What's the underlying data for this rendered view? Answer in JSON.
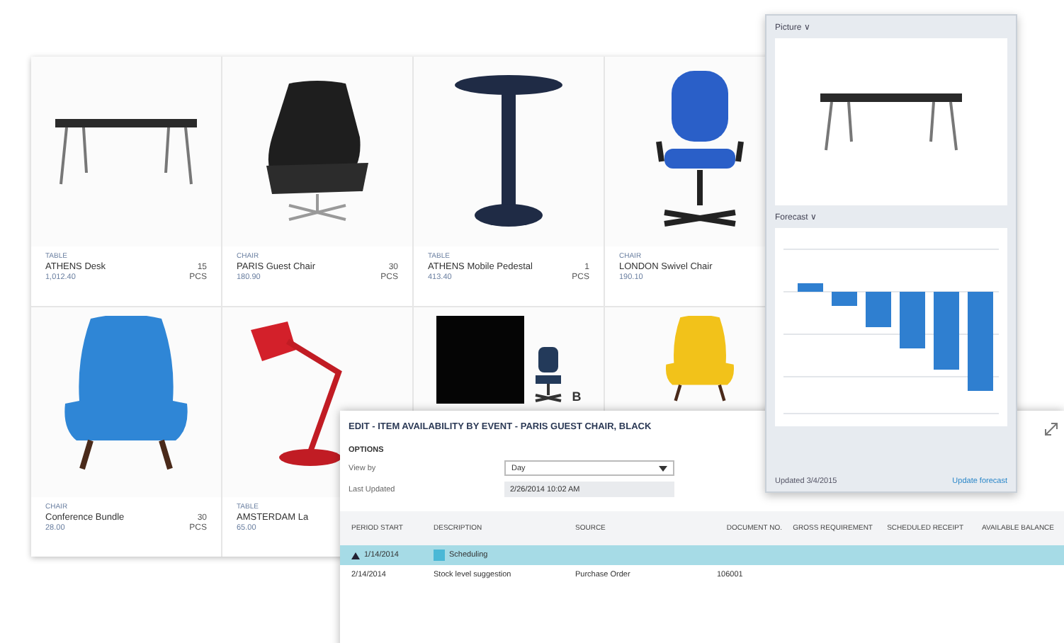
{
  "products": [
    {
      "kind": "desk",
      "category": "TABLE",
      "name": "ATHENS Desk",
      "quantity": "15",
      "price": "1,012.40",
      "unit": "PCS"
    },
    {
      "kind": "lounge",
      "category": "CHAIR",
      "name": "PARIS Guest Chair",
      "quantity": "30",
      "price": "180.90",
      "unit": "PCS"
    },
    {
      "kind": "pedestal",
      "category": "TABLE",
      "name": "ATHENS Mobile Pedestal",
      "quantity": "1",
      "price": "413.40",
      "unit": "PCS"
    },
    {
      "kind": "office",
      "category": "CHAIR",
      "name": "LONDON Swivel Chair",
      "price": "190.10"
    },
    {
      "kind": "armchair",
      "color": "#2f86d6",
      "category": "CHAIR",
      "name": "Conference Bundle",
      "quantity": "30",
      "price": "28.00",
      "unit": "PCS"
    },
    {
      "kind": "lamp",
      "category": "TABLE",
      "name": "AMSTERDAM La",
      "price": "65.00"
    },
    {
      "kind": "dark",
      "caption": "B"
    },
    {
      "kind": "armchair",
      "color": "#f2c21a"
    }
  ],
  "picture_panel": {
    "title": "Picture ∨"
  },
  "forecast_panel": {
    "title": "Forecast ∨",
    "updated": "Updated 3/4/2015",
    "action": "Update forecast"
  },
  "dialog": {
    "title": "EDIT - ITEM AVAILABILITY BY EVENT - PARIS GUEST CHAIR, BLACK",
    "section": "OPTIONS",
    "fields": [
      {
        "kind": "select",
        "label": "View by",
        "value": "Day"
      },
      {
        "kind": "readonly",
        "label": "Last Updated",
        "value": "2/26/2014 10:02 AM"
      }
    ],
    "table": {
      "columns": [
        "PERIOD START",
        "DESCRIPTION",
        "SOURCE",
        "DOCUMENT NO.",
        "GROSS REQUIREMENT",
        "SCHEDULED RECEIPT",
        "AVAILABLE BALANCE"
      ],
      "rows": [
        {
          "selected": true,
          "expanded": true,
          "cells": [
            "1/14/2014",
            "Scheduling",
            "",
            "",
            "",
            "",
            ""
          ]
        },
        {
          "selected": false,
          "cells": [
            "2/14/2014",
            "Stock level suggestion",
            "Purchase Order",
            "106001",
            "",
            "",
            ""
          ]
        }
      ]
    }
  }
}
